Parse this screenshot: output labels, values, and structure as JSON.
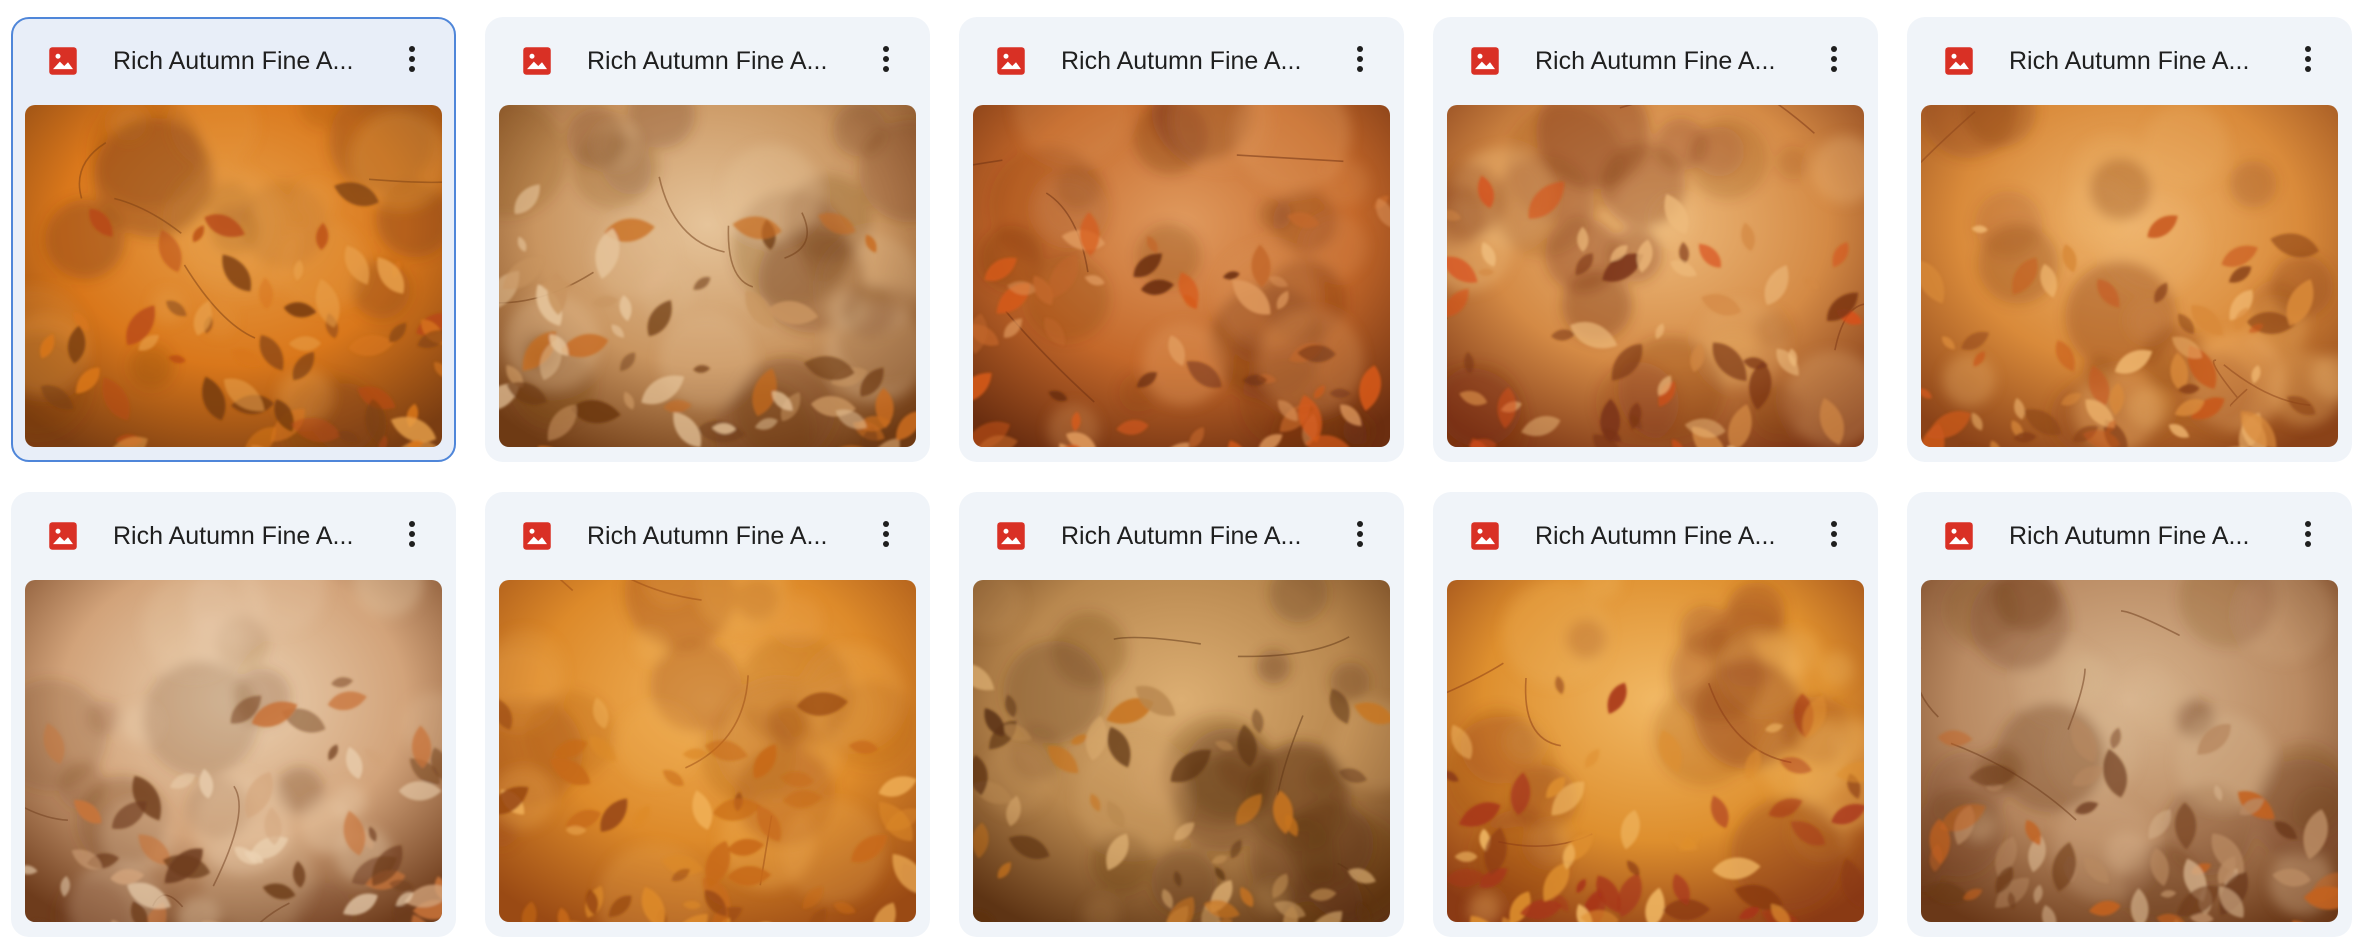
{
  "files": [
    {
      "name": "Rich Autumn Fine A...",
      "icon": "image-file-icon",
      "selected": true,
      "colors": {
        "base": "#d9771b",
        "light": "#e8a04a",
        "dark": "#7a3d12",
        "leaf": "#b94a15"
      }
    },
    {
      "name": "Rich Autumn Fine A...",
      "icon": "image-file-icon",
      "selected": false,
      "colors": {
        "base": "#c99560",
        "light": "#e6c49a",
        "dark": "#6e3a14",
        "leaf": "#c86b1e"
      }
    },
    {
      "name": "Rich Autumn Fine A...",
      "icon": "image-file-icon",
      "selected": false,
      "colors": {
        "base": "#c4682a",
        "light": "#e09a5e",
        "dark": "#6b2e10",
        "leaf": "#d75a1a"
      }
    },
    {
      "name": "Rich Autumn Fine A...",
      "icon": "image-file-icon",
      "selected": false,
      "colors": {
        "base": "#d48a45",
        "light": "#eebb7c",
        "dark": "#7a3414",
        "leaf": "#d94f18"
      }
    },
    {
      "name": "Rich Autumn Fine A...",
      "icon": "image-file-icon",
      "selected": false,
      "colors": {
        "base": "#d98a3a",
        "light": "#efb56e",
        "dark": "#8a4218",
        "leaf": "#c9581c"
      }
    },
    {
      "name": "Rich Autumn Fine A...",
      "icon": "image-file-icon",
      "selected": false,
      "colors": {
        "base": "#d2a37a",
        "light": "#ecd2b2",
        "dark": "#6e3c1c",
        "leaf": "#c9743a"
      }
    },
    {
      "name": "Rich Autumn Fine A...",
      "icon": "image-file-icon",
      "selected": false,
      "colors": {
        "base": "#dd8a2a",
        "light": "#f0b058",
        "dark": "#9a4a14",
        "leaf": "#c86a18"
      }
    },
    {
      "name": "Rich Autumn Fine A...",
      "icon": "image-file-icon",
      "selected": false,
      "colors": {
        "base": "#b8874e",
        "light": "#dcae72",
        "dark": "#5e3414",
        "leaf": "#c8741e"
      }
    },
    {
      "name": "Rich Autumn Fine A...",
      "icon": "image-file-icon",
      "selected": false,
      "colors": {
        "base": "#de8f2e",
        "light": "#f1b864",
        "dark": "#8a3a14",
        "leaf": "#a8341a"
      }
    },
    {
      "name": "Rich Autumn Fine A...",
      "icon": "image-file-icon",
      "selected": false,
      "colors": {
        "base": "#b98a62",
        "light": "#d9b690",
        "dark": "#6a3818",
        "leaf": "#c4621e"
      }
    }
  ],
  "theme": {
    "icon_red": "#d93025",
    "text": "#1f1f1f",
    "card_bg": "#f0f4f9",
    "selected_border": "#4f86d9"
  }
}
